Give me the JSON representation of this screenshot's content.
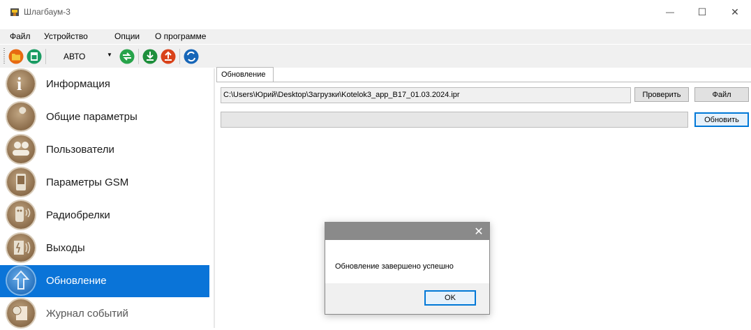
{
  "window": {
    "title": "Шлагбаум-3",
    "minimize_label": "—",
    "maximize_label": "☐",
    "close_label": "✕"
  },
  "menu": [
    "Файл",
    "Устройство",
    "Опции",
    "О программе"
  ],
  "toolbar": {
    "mode_value": "АВТО",
    "icons": [
      "open-folder-icon",
      "save-icon",
      "sync-icon",
      "download-icon",
      "upload-icon",
      "refresh-icon"
    ]
  },
  "sidebar": {
    "items": [
      {
        "label": "Информация",
        "icon": "info-icon"
      },
      {
        "label": "Общие параметры",
        "icon": "wrench-icon"
      },
      {
        "label": "Пользователи",
        "icon": "users-icon"
      },
      {
        "label": "Параметры GSM",
        "icon": "phone-icon"
      },
      {
        "label": "Радиобрелки",
        "icon": "remote-icon"
      },
      {
        "label": "Выходы",
        "icon": "outputs-icon"
      },
      {
        "label": "Обновление",
        "icon": "update-arrow-icon",
        "active": true
      },
      {
        "label": "Журнал событий",
        "icon": "log-icon"
      }
    ],
    "active_color": "#0a74d8"
  },
  "content": {
    "tab_label": "Обновление",
    "file_path": "C:\\Users\\Юрий\\Desktop\\Загрузки\\Kotelok3_app_B17_01.03.2024.ipr",
    "check_button": "Проверить",
    "file_button": "Файл",
    "update_button": "Обновить",
    "progress_fraction": 0
  },
  "dialog": {
    "close_label": "✕",
    "message": "Обновление завершено успешно",
    "ok_label": "OK"
  }
}
